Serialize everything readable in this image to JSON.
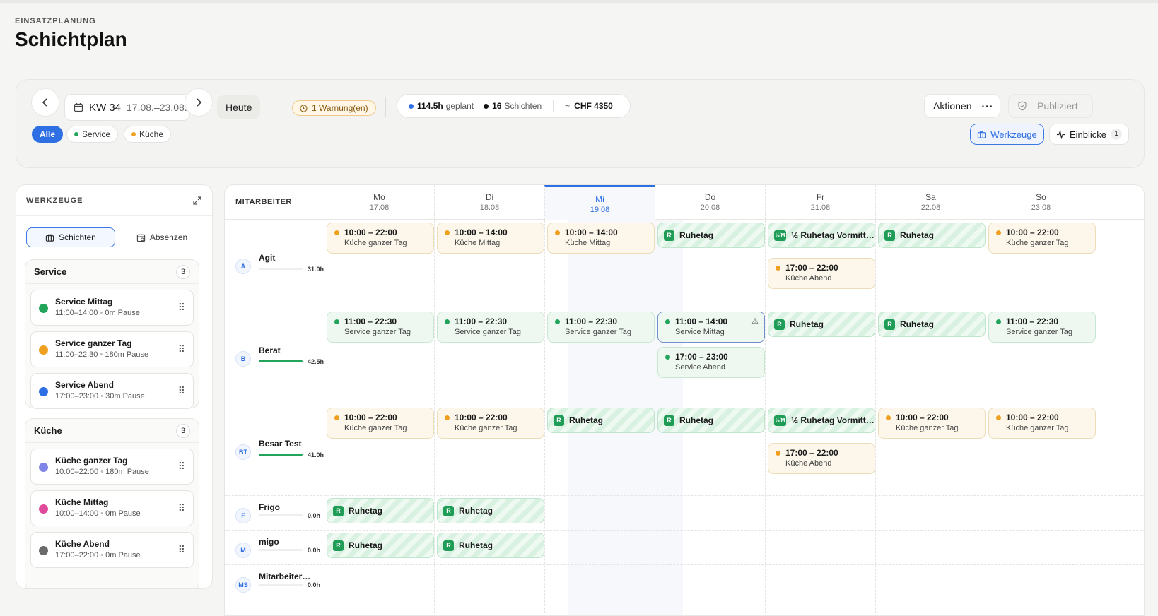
{
  "header": {
    "overline": "EINSATZPLANUNG",
    "title": "Schichtplan"
  },
  "toolbar": {
    "prev_icon": "chevron-left",
    "next_icon": "chevron-right",
    "week_label": "KW 34",
    "week_range": "17.08.–23.08.",
    "today_label": "Heute",
    "warning_label": "1 Warnung(en)",
    "stats": {
      "hours_value": "114.5h",
      "hours_label": "geplant",
      "shifts_value": "16",
      "shifts_label": "Schichten",
      "cost_prefix": "~",
      "cost_value": "CHF 4350"
    },
    "actions_label": "Aktionen",
    "publish_label": "Publiziert",
    "filters": {
      "all": "Alle",
      "service": "Service",
      "kitchen": "Küche"
    },
    "tools_label": "Werkzeuge",
    "insights_label": "Einblicke",
    "insights_count": "1"
  },
  "colors": {
    "accent": "#2f6fe4",
    "service": "#22a55a",
    "kitchen": "#f0a020",
    "rest": "#1f9d57"
  },
  "tools_panel": {
    "title": "WERKZEUGE",
    "tab_shifts": "Schichten",
    "tab_absences": "Absenzen",
    "groups": [
      {
        "name": "Service",
        "count": "3",
        "items": [
          {
            "name": "Service Mittag",
            "time": "11:00–14:00",
            "pause": "0m Pause",
            "color": "#22a55a"
          },
          {
            "name": "Service ganzer Tag",
            "time": "11:00–22:30",
            "pause": "180m Pause",
            "color": "#f0a020"
          },
          {
            "name": "Service Abend",
            "time": "17:00–23:00",
            "pause": "30m Pause",
            "color": "#2f6fe4"
          }
        ]
      },
      {
        "name": "Küche",
        "count": "3",
        "items": [
          {
            "name": "Küche ganzer Tag",
            "time": "10:00–22:00",
            "pause": "180m Pause",
            "color": "#7f86e8"
          },
          {
            "name": "Küche Mittag",
            "time": "10:00–14:00",
            "pause": "0m Pause",
            "color": "#e04a9a"
          },
          {
            "name": "Küche Abend",
            "time": "17:00–22:00",
            "pause": "0m Pause",
            "color": "#6a6a6a"
          }
        ]
      }
    ]
  },
  "grid": {
    "employee_header": "MITARBEITER",
    "days": [
      {
        "day": "Mo",
        "date": "17.08"
      },
      {
        "day": "Di",
        "date": "18.08"
      },
      {
        "day": "Mi",
        "date": "19.08"
      },
      {
        "day": "Do",
        "date": "20.08"
      },
      {
        "day": "Fr",
        "date": "21.08"
      },
      {
        "day": "Sa",
        "date": "22.08"
      },
      {
        "day": "So",
        "date": "23.08"
      }
    ],
    "employees": [
      {
        "initials": "A",
        "name": "Agit",
        "hours": "31.0h",
        "fill": 0
      },
      {
        "initials": "B",
        "name": "Berat",
        "hours": "42.5h",
        "fill": 1
      },
      {
        "initials": "BT",
        "name": "Besar Test",
        "hours": "41.0h",
        "fill": 1
      },
      {
        "initials": "F",
        "name": "Frigo",
        "hours": "0.0h",
        "fill": 0
      },
      {
        "initials": "M",
        "name": "migo",
        "hours": "0.0h",
        "fill": 0
      },
      {
        "initials": "MS",
        "name": "Mitarbeiter…",
        "hours": "0.0h",
        "fill": 0
      }
    ],
    "shift_labels": {
      "k_10_22": {
        "time": "10:00 – 22:00",
        "label": "Küche ganzer Tag"
      },
      "k_10_14": {
        "time": "10:00 – 14:00",
        "label": "Küche Mittag"
      },
      "k_17_22": {
        "time": "17:00 – 22:00",
        "label": "Küche Abend"
      },
      "s_11_2230": {
        "time": "11:00 – 22:30",
        "label": "Service ganzer Tag"
      },
      "s_11_14": {
        "time": "11:00 – 14:00",
        "label": "Service Mittag"
      },
      "s_17_23": {
        "time": "17:00 – 23:00",
        "label": "Service Abend"
      },
      "rest": "Ruhetag",
      "rest_badge": "R",
      "half_rest": "½ Ruhetag Vormitt…",
      "half_badge": "½/M"
    }
  }
}
